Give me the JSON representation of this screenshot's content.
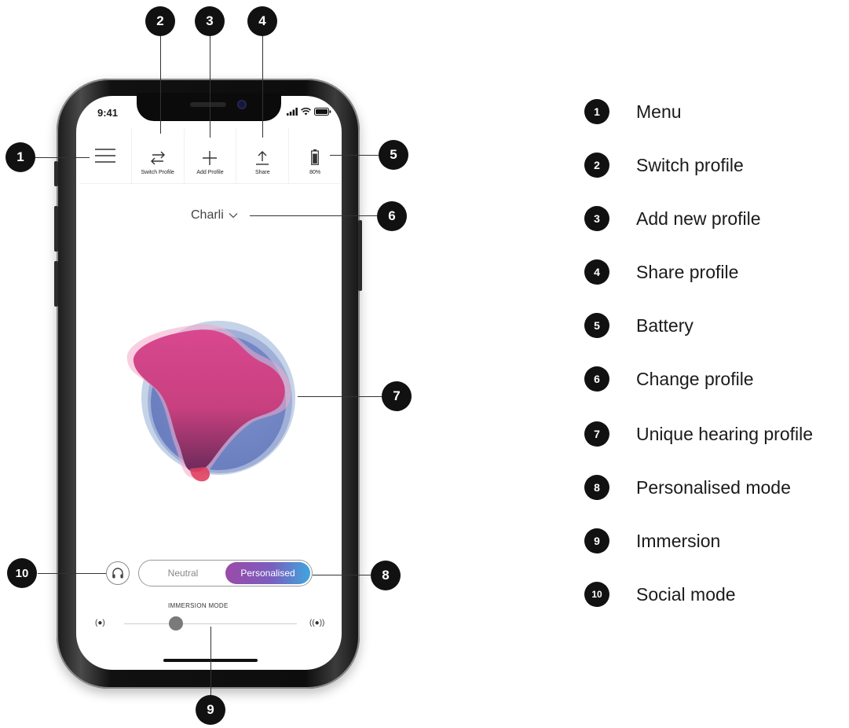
{
  "status_bar": {
    "time": "9:41"
  },
  "toolbar": {
    "switch_profile": "Switch Profile",
    "add_profile": "Add Profile",
    "share": "Share",
    "battery": "80%"
  },
  "profile": {
    "name": "Charli"
  },
  "mode_toggle": {
    "options": [
      "Neutral",
      "Personalised"
    ],
    "selected": "Personalised"
  },
  "immersion": {
    "title": "IMMERSION MODE",
    "level_fraction": 0.3
  },
  "callouts": [
    "1",
    "2",
    "3",
    "4",
    "5",
    "6",
    "7",
    "8",
    "9",
    "10"
  ],
  "legend": [
    {
      "num": "1",
      "label": "Menu"
    },
    {
      "num": "2",
      "label": "Switch profile"
    },
    {
      "num": "3",
      "label": "Add new profile"
    },
    {
      "num": "4",
      "label": "Share profile"
    },
    {
      "num": "5",
      "label": "Battery"
    },
    {
      "num": "6",
      "label": "Change profile"
    },
    {
      "num": "7",
      "label": "Unique hearing profile"
    },
    {
      "num": "8",
      "label": "Personalised mode"
    },
    {
      "num": "9",
      "label": "Immersion"
    },
    {
      "num": "10",
      "label": "Social mode"
    }
  ],
  "colors": {
    "badge": "#111111",
    "accent_start": "#9b4aa8",
    "accent_end": "#3fa6dd"
  }
}
